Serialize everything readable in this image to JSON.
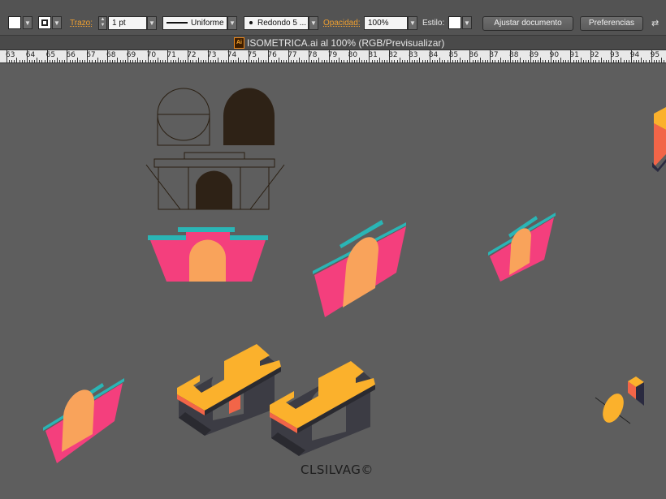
{
  "control_bar": {
    "stroke_label": "Trazo:",
    "stroke_weight": "1 pt",
    "variable_width_profile": "Uniforme",
    "brush": "Redondo 5 ...",
    "opacity_label": "Opacidad:",
    "opacity_value": "100%",
    "style_label": "Estilo:",
    "document_setup_button": "Ajustar documento",
    "preferences_button": "Preferencias"
  },
  "document_tab": {
    "title": "ISOMETRICA.ai al 100% (RGB/Previsualizar)",
    "file_icon_text": "Ai"
  },
  "ruler": {
    "labels": [
      "63",
      "64",
      "65",
      "66",
      "67",
      "68",
      "69",
      "70",
      "71",
      "72",
      "73",
      "74",
      "75",
      "76",
      "77",
      "78",
      "79",
      "80",
      "81",
      "82",
      "83",
      "84",
      "85",
      "86",
      "87",
      "88",
      "89",
      "90",
      "91",
      "92",
      "93",
      "94",
      "95"
    ]
  },
  "canvas": {
    "signature": "CLSILVAG©"
  },
  "colors": {
    "pink": "#f43f7d",
    "peach": "#f9a35b",
    "teal": "#2ab5b5",
    "yellow": "#fbb12c",
    "coral": "#f26548",
    "dark_gray": "#3c3c44",
    "dark_brown": "#2a1f12",
    "canvas": "#5e5e5e"
  }
}
